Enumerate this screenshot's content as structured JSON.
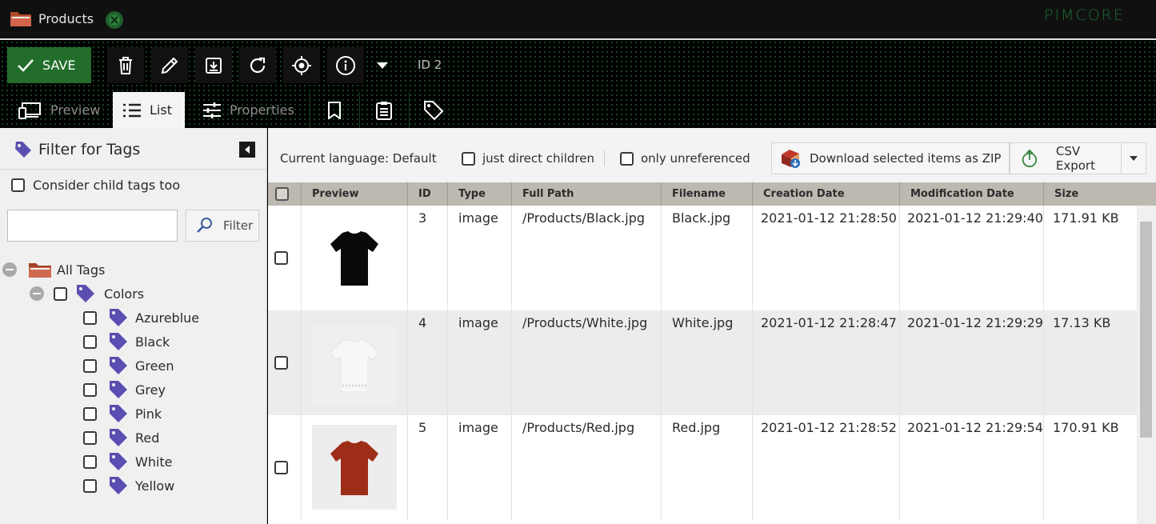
{
  "window": {
    "title": "Products",
    "brand": "PIMCORE"
  },
  "toolbar": {
    "save_label": "SAVE",
    "id_label": "ID 2",
    "icons": [
      "delete-icon",
      "edit-icon",
      "download-icon",
      "reload-icon",
      "target-icon",
      "info-icon",
      "dropdown-arrow-icon"
    ]
  },
  "tabs": [
    {
      "label": "Preview",
      "icon": "devices-icon"
    },
    {
      "label": "List",
      "icon": "list-icon",
      "active": true
    },
    {
      "label": "Properties",
      "icon": "sliders-icon"
    },
    {
      "label": "",
      "icon": "bookmark-icon"
    },
    {
      "label": "",
      "icon": "clipboard-icon"
    },
    {
      "label": "",
      "icon": "tag-icon"
    }
  ],
  "filter_panel": {
    "title": "Filter for Tags",
    "consider_child": "Consider child tags too",
    "search_value": "",
    "filter_button": "Filter",
    "tree": {
      "root": "All Tags",
      "group": "Colors",
      "tags": [
        "Azureblue",
        "Black",
        "Green",
        "Grey",
        "Pink",
        "Red",
        "White",
        "Yellow"
      ]
    }
  },
  "grid_toolbar": {
    "language": "Current language: Default",
    "direct_children": "just direct children",
    "unreferenced": "only unreferenced",
    "zip_button": "Download selected items as ZIP",
    "csv_button": "CSV Export"
  },
  "grid": {
    "columns": [
      "Preview",
      "ID",
      "Type",
      "Full Path",
      "Filename",
      "Creation Date",
      "Modification Date",
      "Size"
    ],
    "rows": [
      {
        "id": "3",
        "type": "image",
        "path": "/Products/Black.jpg",
        "filename": "Black.jpg",
        "created": "2021-01-12 21:28:50",
        "modified": "2021-01-12 21:29:40",
        "size": "171.91 KB",
        "shirt_color": "#0a0a0a"
      },
      {
        "id": "4",
        "type": "image",
        "path": "/Products/White.jpg",
        "filename": "White.jpg",
        "created": "2021-01-12 21:28:47",
        "modified": "2021-01-12 21:29:29",
        "size": "17.13 KB",
        "shirt_color": "#f7f7f7"
      },
      {
        "id": "5",
        "type": "image",
        "path": "/Products/Red.jpg",
        "filename": "Red.jpg",
        "created": "2021-01-12 21:28:52",
        "modified": "2021-01-12 21:29:54",
        "size": "170.91 KB",
        "shirt_color": "#9e2d17"
      }
    ]
  },
  "colors": {
    "save_green": "#236d2b",
    "tag_purple": "#5a4fb0",
    "header_bg": "#bdb9b1"
  }
}
